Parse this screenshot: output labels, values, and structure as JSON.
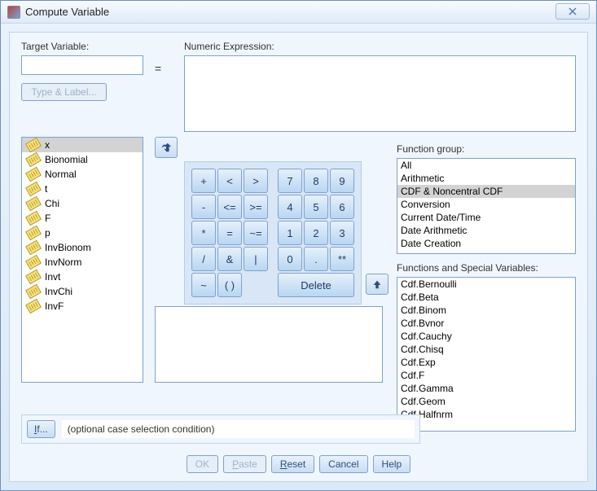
{
  "window": {
    "title": "Compute Variable"
  },
  "labels": {
    "target_variable": "Target Variable:",
    "numeric_expression": "Numeric Expression:",
    "type_label_btn": "Type & Label...",
    "equals": "=",
    "function_group": "Function group:",
    "functions_special": "Functions and Special Variables:",
    "if_btn": "If...",
    "if_desc": "(optional case selection condition)"
  },
  "inputs": {
    "target_variable_value": "",
    "numeric_expression_value": "",
    "help_textarea_value": ""
  },
  "variables": {
    "items": [
      "x",
      "Bionomial",
      "Normal",
      "t",
      "Chi",
      "F",
      "p",
      "InvBionom",
      "InvNorm",
      "Invt",
      "InvChi",
      "InvF"
    ],
    "selected_index": 0
  },
  "calculator": {
    "rows": [
      [
        "+",
        "<",
        ">",
        "7",
        "8",
        "9"
      ],
      [
        "-",
        "<=",
        ">=",
        "4",
        "5",
        "6"
      ],
      [
        "*",
        "=",
        "~=",
        "1",
        "2",
        "3"
      ],
      [
        "/",
        "&",
        "|",
        "0",
        ".",
        ""
      ],
      [
        "**",
        "~",
        "( )",
        "Delete",
        "",
        ""
      ]
    ]
  },
  "function_groups": {
    "items": [
      "All",
      "Arithmetic",
      "CDF & Noncentral CDF",
      "Conversion",
      "Current Date/Time",
      "Date Arithmetic",
      "Date Creation"
    ],
    "selected_index": 2
  },
  "functions": {
    "items": [
      "Cdf.Bernoulli",
      "Cdf.Beta",
      "Cdf.Binom",
      "Cdf.Bvnor",
      "Cdf.Cauchy",
      "Cdf.Chisq",
      "Cdf.Exp",
      "Cdf.F",
      "Cdf.Gamma",
      "Cdf.Geom",
      "Cdf.Halfnrm"
    ]
  },
  "footer": {
    "ok": "OK",
    "paste": "Paste",
    "reset": "Reset",
    "cancel": "Cancel",
    "help": "Help"
  }
}
